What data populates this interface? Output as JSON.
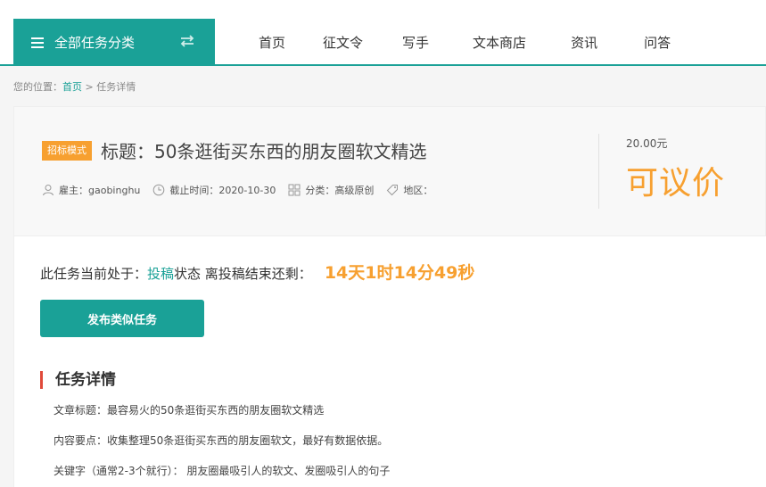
{
  "header": {
    "category_button": "全部任务分类",
    "nav": [
      "首页",
      "征文令",
      "写手",
      "文本商店",
      "资讯",
      "问答"
    ]
  },
  "breadcrumb": {
    "prefix": "您的位置：",
    "home": "首页",
    "separator": " > ",
    "current": "任务详情"
  },
  "task": {
    "mode_badge": "招标模式",
    "title": "标题：50条逛街买东西的朋友圈软文精选",
    "employer_label": "雇主：",
    "employer": "gaobinghu",
    "deadline_label": "截止时间：",
    "deadline": "2020-10-30",
    "category_label": "分类：",
    "category": "高级原创",
    "region_label": "地区：",
    "region": "",
    "price": "20.00元",
    "negotiable": "可议价"
  },
  "status": {
    "prefix": "此任务当前处于：",
    "state": "投稿",
    "middle": "状态 离投稿结束还剩：",
    "countdown": "14天1时14分49秒"
  },
  "publish_button": "发布类似任务",
  "details": {
    "section_title": "任务详情",
    "lines": [
      "文章标题：最容易火的50条逛街买东西的朋友圈软文精选",
      "内容要点：收集整理50条逛街买东西的朋友圈软文，最好有数据依据。",
      "关键字（通常2-3个就行）：  朋友圈最吸引人的软文、发圈吸引人的句子"
    ]
  },
  "colors": {
    "accent": "#1aa197",
    "orange": "#f7a030",
    "red_bar": "#e04a3a"
  },
  "icons": [
    "menu-icon",
    "swap-icon",
    "user-icon",
    "clock-icon",
    "grid-icon",
    "tag-icon"
  ]
}
